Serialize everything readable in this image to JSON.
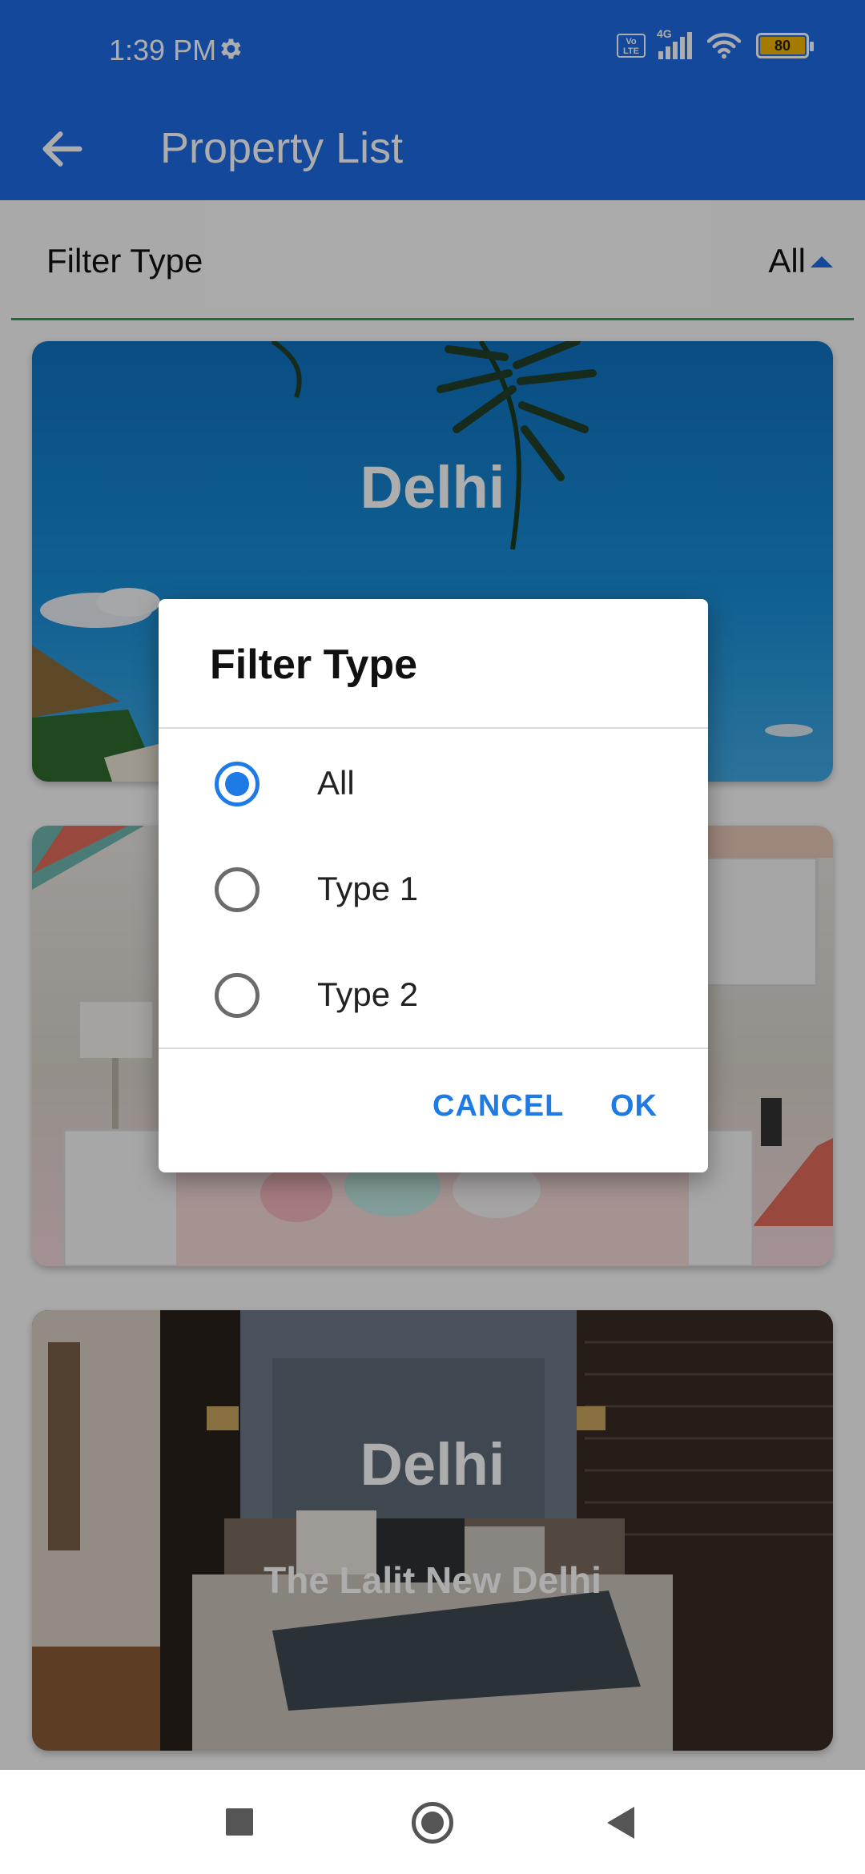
{
  "status_bar": {
    "time": "1:39 PM",
    "volte": "Vo LTE",
    "network": "4G",
    "battery": "80"
  },
  "app_bar": {
    "title": "Property List"
  },
  "filter": {
    "label": "Filter Type",
    "value": "All"
  },
  "cards": [
    {
      "city": "Delhi",
      "subtitle": ""
    },
    {
      "city": "",
      "subtitle": ""
    },
    {
      "city": "Delhi",
      "subtitle": "The Lalit New Delhi"
    }
  ],
  "dialog": {
    "title": "Filter Type",
    "options": [
      {
        "label": "All",
        "selected": true
      },
      {
        "label": "Type 1",
        "selected": false
      },
      {
        "label": "Type 2",
        "selected": false
      }
    ],
    "cancel": "CANCEL",
    "ok": "OK"
  },
  "colors": {
    "primary": "#1D6AE5",
    "accent": "#1E7BE6",
    "filter_underline": "#2E9D4A"
  }
}
